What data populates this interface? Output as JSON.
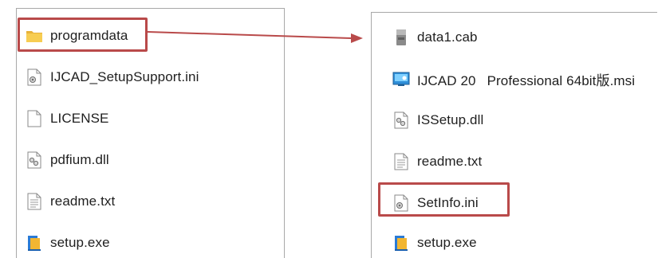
{
  "left": {
    "items": [
      {
        "label": "programdata",
        "icon": "folder-icon"
      },
      {
        "label": "IJCAD_SetupSupport.ini",
        "icon": "settings-file-icon"
      },
      {
        "label": "LICENSE",
        "icon": "blank-file-icon"
      },
      {
        "label": "pdfium.dll",
        "icon": "dll-file-icon"
      },
      {
        "label": "readme.txt",
        "icon": "text-file-icon"
      },
      {
        "label": "setup.exe",
        "icon": "installer-icon"
      }
    ]
  },
  "right": {
    "items": [
      {
        "label": "data1.cab",
        "icon": "cabinet-file-icon"
      },
      {
        "label_a": "IJCAD 20",
        "label_b": "Professional 64bit版.msi",
        "icon": "msi-package-icon"
      },
      {
        "label": "ISSetup.dll",
        "icon": "dll-file-icon"
      },
      {
        "label": "readme.txt",
        "icon": "text-file-icon"
      },
      {
        "label": "SetInfo.ini",
        "icon": "settings-file-icon"
      },
      {
        "label": "setup.exe",
        "icon": "installer-icon"
      }
    ]
  },
  "colors": {
    "highlight": "#b94a4a",
    "folder": "#f5c242"
  }
}
